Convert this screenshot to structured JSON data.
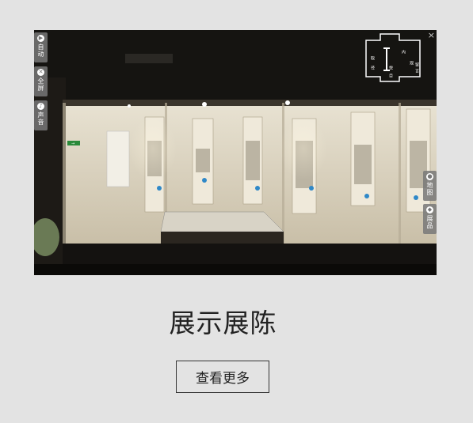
{
  "viewer": {
    "left_controls": [
      {
        "label": "自动",
        "icon": "auto-play-icon"
      },
      {
        "label": "全屏",
        "icon": "fullscreen-icon"
      },
      {
        "label": "声音",
        "icon": "sound-icon"
      }
    ],
    "right_controls": [
      {
        "label": "地图",
        "icon": "map-pin-icon"
      },
      {
        "label": "展品",
        "icon": "exhibit-vase-icon"
      }
    ],
    "close_glyph": "×",
    "logo_text": [
      "取",
      "径",
      "悦",
      "目",
      "内",
      "观",
      "留",
      "言"
    ],
    "exit_sign": "→"
  },
  "section": {
    "title": "展示展陈",
    "more_button": "查看更多"
  }
}
